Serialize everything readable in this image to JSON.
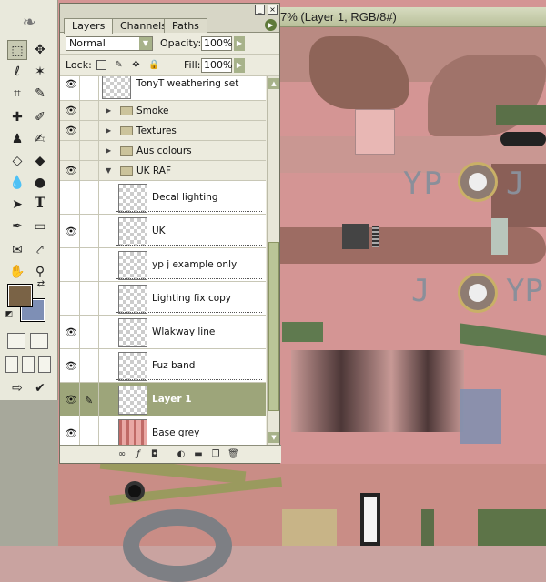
{
  "document": {
    "title_fragment": "7% (Layer 1, RGB/8#)"
  },
  "texture_markings": {
    "letters_top": "YP",
    "letter_top_right": "J",
    "letters_mid": "J",
    "letters_mid_right": "YP"
  },
  "palette": {
    "tabs": [
      "Layers",
      "Channels",
      "Paths"
    ],
    "active_tab": "Layers",
    "blend_mode": "Normal",
    "opacity_label": "Opacity:",
    "opacity_value": "100%",
    "lock_label": "Lock:",
    "fill_label": "Fill:",
    "fill_value": "100%",
    "layers": [
      {
        "name": "TonyT weathering set",
        "type": "layer",
        "visible": true,
        "partial": true
      },
      {
        "name": "Smoke",
        "type": "group",
        "visible": true,
        "expanded": false
      },
      {
        "name": "Textures",
        "type": "group",
        "visible": true,
        "expanded": false
      },
      {
        "name": "Aus colours",
        "type": "group",
        "visible": false,
        "expanded": false
      },
      {
        "name": "UK RAF",
        "type": "group",
        "visible": true,
        "expanded": true
      },
      {
        "name": "Decal lighting",
        "type": "layer",
        "visible": false
      },
      {
        "name": "UK",
        "type": "layer",
        "visible": true
      },
      {
        "name": "yp  j example only",
        "type": "layer",
        "visible": false
      },
      {
        "name": "Lighting fix copy",
        "type": "layer",
        "visible": false
      },
      {
        "name": "Wlakway line",
        "type": "layer",
        "visible": true
      },
      {
        "name": "Fuz band",
        "type": "layer",
        "visible": true
      },
      {
        "name": "Layer 1",
        "type": "layer",
        "visible": true,
        "selected": true
      },
      {
        "name": "Base grey",
        "type": "layer",
        "visible": true
      }
    ]
  },
  "colors": {
    "foreground": "#7a6346",
    "background": "#7e8fb5",
    "selection": "#9da57a"
  }
}
